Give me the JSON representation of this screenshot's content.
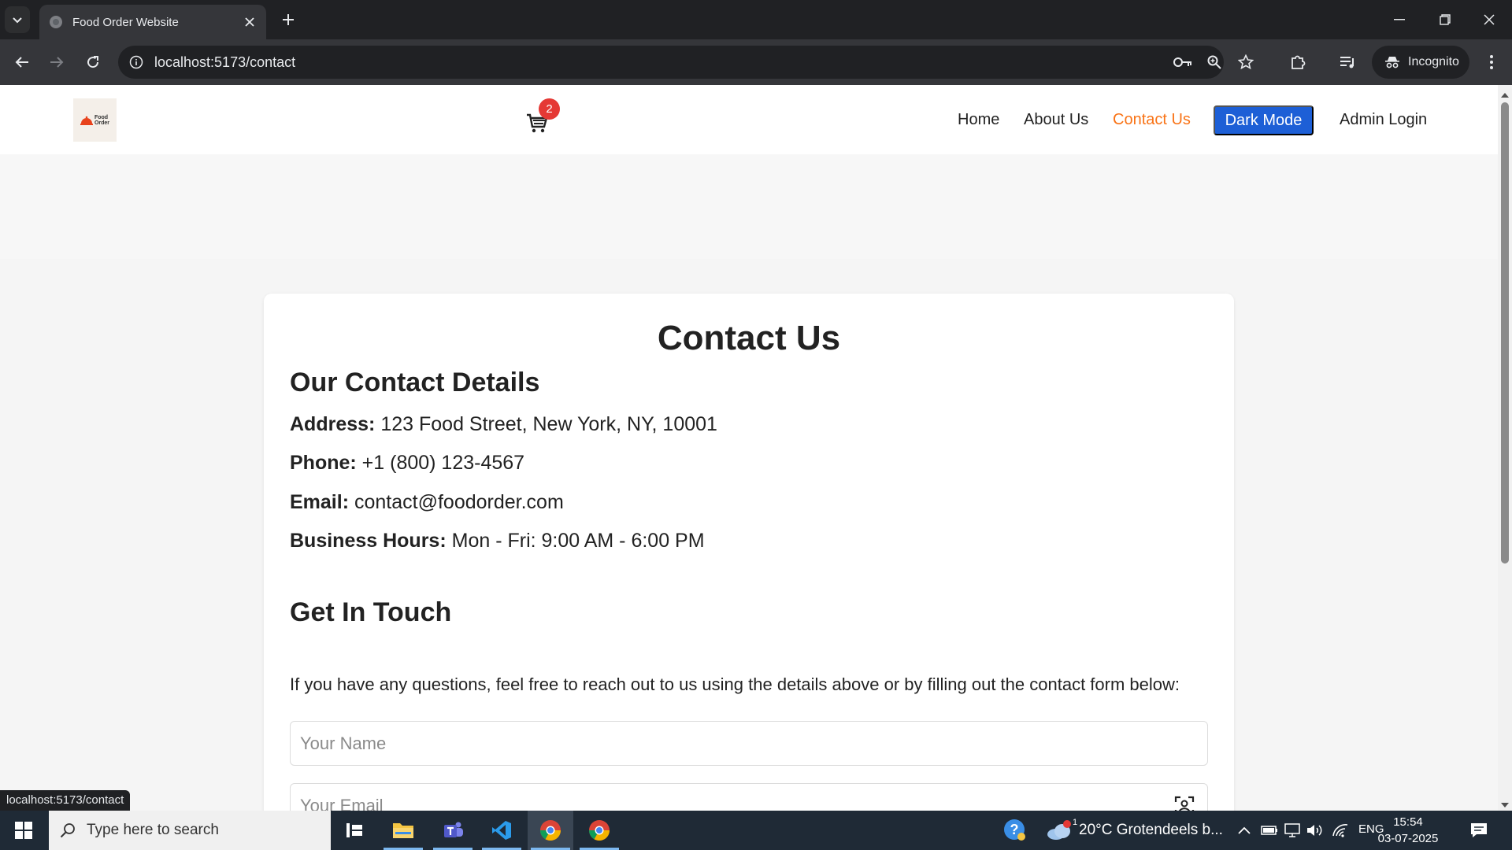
{
  "browser": {
    "tab_title": "Food Order Website",
    "url": "localhost:5173/contact",
    "profile_label": "Incognito",
    "status_url": "localhost:5173/contact"
  },
  "site": {
    "logo_text_line1": "Food",
    "logo_text_line2": "Order",
    "cart_count": "2",
    "nav": {
      "home": "Home",
      "about": "About Us",
      "contact": "Contact Us",
      "dark_mode": "Dark Mode",
      "admin": "Admin Login"
    },
    "accent_color": "#f97316",
    "button_color": "#1d5fd6"
  },
  "contact": {
    "title": "Contact Us",
    "details_heading": "Our Contact Details",
    "address_label": "Address:",
    "address_value": "123 Food Street, New York, NY, 10001",
    "phone_label": "Phone:",
    "phone_value": "+1 (800) 123-4567",
    "email_label": "Email:",
    "email_value": "contact@foodorder.com",
    "hours_label": "Business Hours:",
    "hours_value": "Mon - Fri: 9:00 AM - 6:00 PM",
    "touch_heading": "Get In Touch",
    "intro": "If you have any questions, feel free to reach out to us using the details above or by filling out the contact form below:",
    "name_placeholder": "Your Name",
    "email_placeholder": "Your Email"
  },
  "taskbar": {
    "search_placeholder": "Type here to search",
    "weather": "20°C  Grotendeels b...",
    "weather_badge": "1",
    "language": "ENG",
    "time": "15:54",
    "date": "03-07-2025"
  }
}
